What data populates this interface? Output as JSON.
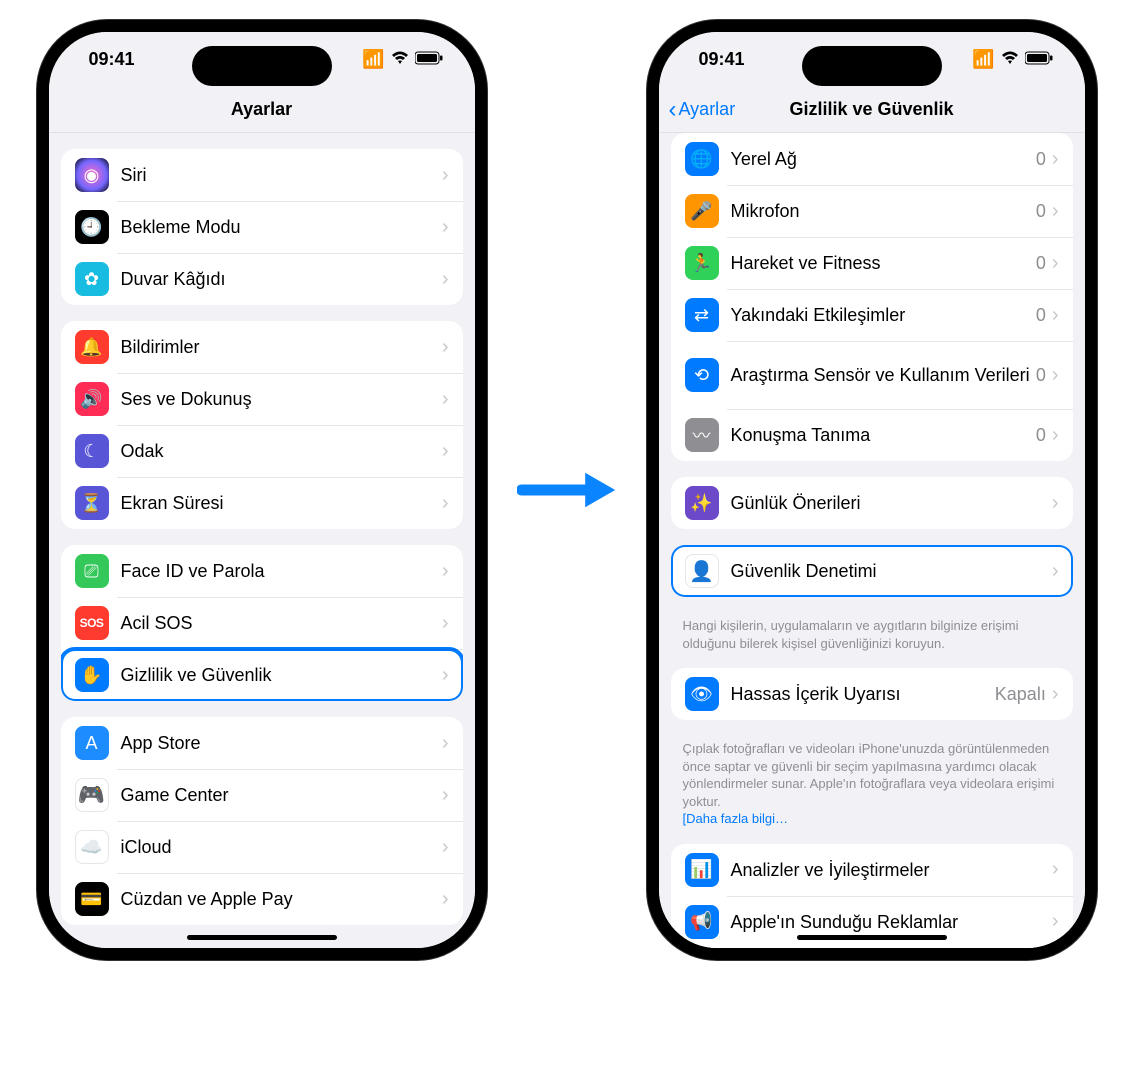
{
  "status": {
    "time": "09:41"
  },
  "phone1": {
    "title": "Ayarlar",
    "groups": [
      {
        "rows": [
          {
            "key": "siri",
            "icon": "siri",
            "iconClass": "ic-siri",
            "glyph": "◉",
            "label": "Siri"
          },
          {
            "key": "standby",
            "icon": "standby",
            "iconClass": "ic-standby",
            "glyph": "🕘",
            "label": "Bekleme Modu"
          },
          {
            "key": "wallpaper",
            "icon": "wallpaper",
            "iconClass": "ic-wallpaper",
            "glyph": "✿",
            "label": "Duvar Kâğıdı"
          }
        ]
      },
      {
        "rows": [
          {
            "key": "notifications",
            "icon": "bell",
            "iconClass": "ic-notif",
            "glyph": "🔔",
            "label": "Bildirimler"
          },
          {
            "key": "sound",
            "icon": "speaker",
            "iconClass": "ic-sound",
            "glyph": "🔊",
            "label": "Ses ve Dokunuş"
          },
          {
            "key": "focus",
            "icon": "moon",
            "iconClass": "ic-focus",
            "glyph": "☾",
            "label": "Odak"
          },
          {
            "key": "screentime",
            "icon": "hourglass",
            "iconClass": "ic-screentime",
            "glyph": "⏳",
            "label": "Ekran Süresi"
          }
        ]
      },
      {
        "rows": [
          {
            "key": "faceid",
            "icon": "faceid",
            "iconClass": "ic-faceid",
            "glyph": "⎚",
            "label": "Face ID ve Parola"
          },
          {
            "key": "sos",
            "icon": "sos",
            "iconClass": "ic-sos",
            "glyph": "SOS",
            "label": "Acil SOS"
          },
          {
            "key": "privacy",
            "icon": "hand",
            "iconClass": "ic-privacy",
            "glyph": "✋",
            "label": "Gizlilik ve Güvenlik",
            "highlight": true
          }
        ]
      },
      {
        "rows": [
          {
            "key": "appstore",
            "icon": "appstore",
            "iconClass": "ic-appstore",
            "glyph": "A",
            "label": "App Store"
          },
          {
            "key": "gamecenter",
            "icon": "gamecenter",
            "iconClass": "ic-gamecenter",
            "glyph": "🎮",
            "label": "Game Center"
          },
          {
            "key": "icloud",
            "icon": "cloud",
            "iconClass": "ic-icloud",
            "glyph": "☁️",
            "label": "iCloud"
          },
          {
            "key": "wallet",
            "icon": "wallet",
            "iconClass": "ic-wallet",
            "glyph": "💳",
            "label": "Cüzdan ve Apple Pay"
          }
        ]
      }
    ]
  },
  "phone2": {
    "back": "Ayarlar",
    "title": "Gizlilik ve Güvenlik",
    "groups": [
      {
        "rows": [
          {
            "key": "localnet",
            "icon": "globe",
            "iconClass": "ic-network",
            "glyph": "🌐",
            "label": "Yerel Ağ",
            "value": "0"
          },
          {
            "key": "microphone",
            "icon": "mic",
            "iconClass": "ic-mic",
            "glyph": "🎤",
            "label": "Mikrofon",
            "value": "0"
          },
          {
            "key": "motion",
            "icon": "runner",
            "iconClass": "ic-motion",
            "glyph": "🏃",
            "label": "Hareket ve Fitness",
            "value": "0"
          },
          {
            "key": "nearby",
            "icon": "nearby",
            "iconClass": "ic-nearby",
            "glyph": "⇄",
            "label": "Yakındaki Etkileşimler",
            "value": "0"
          },
          {
            "key": "research",
            "icon": "research",
            "iconClass": "ic-research",
            "glyph": "⟲",
            "label": "Araştırma Sensör ve Kullanım Verileri",
            "value": "0",
            "tall": true
          },
          {
            "key": "speech",
            "icon": "speech",
            "iconClass": "ic-speech",
            "glyph": "〰",
            "label": "Konuşma Tanıma",
            "value": "0"
          }
        ]
      },
      {
        "rows": [
          {
            "key": "journal",
            "icon": "wand",
            "iconClass": "ic-journal",
            "glyph": "✨",
            "label": "Günlük Önerileri"
          }
        ]
      },
      {
        "rows": [
          {
            "key": "safetycheck",
            "icon": "person-shield",
            "iconClass": "ic-safety",
            "glyph": "👤",
            "label": "Güvenlik Denetimi",
            "highlight": true
          }
        ],
        "footnote": "Hangi kişilerin, uygulamaların ve aygıtların bilginize erişimi olduğunu bilerek kişisel güvenliğinizi koruyun."
      },
      {
        "rows": [
          {
            "key": "sensitive",
            "icon": "eye",
            "iconClass": "ic-sensitive",
            "glyph": "👁",
            "label": "Hassas İçerik Uyarısı",
            "value": "Kapalı"
          }
        ],
        "footnote": "Çıplak fotoğrafları ve videoları iPhone'unuzda görüntülenmeden önce saptar ve güvenli bir seçim yapılmasına yardımcı olacak yönlendirmeler sunar. Apple'ın fotoğraflara veya videolara erişimi yoktur.",
        "footlink": "[Daha fazla bilgi…"
      },
      {
        "rows": [
          {
            "key": "analytics",
            "icon": "chart",
            "iconClass": "ic-analytics",
            "glyph": "📊",
            "label": "Analizler ve İyileştirmeler"
          },
          {
            "key": "ads",
            "icon": "megaphone",
            "iconClass": "ic-ads",
            "glyph": "📢",
            "label": "Apple'ın Sunduğu Reklamlar"
          }
        ]
      }
    ]
  }
}
